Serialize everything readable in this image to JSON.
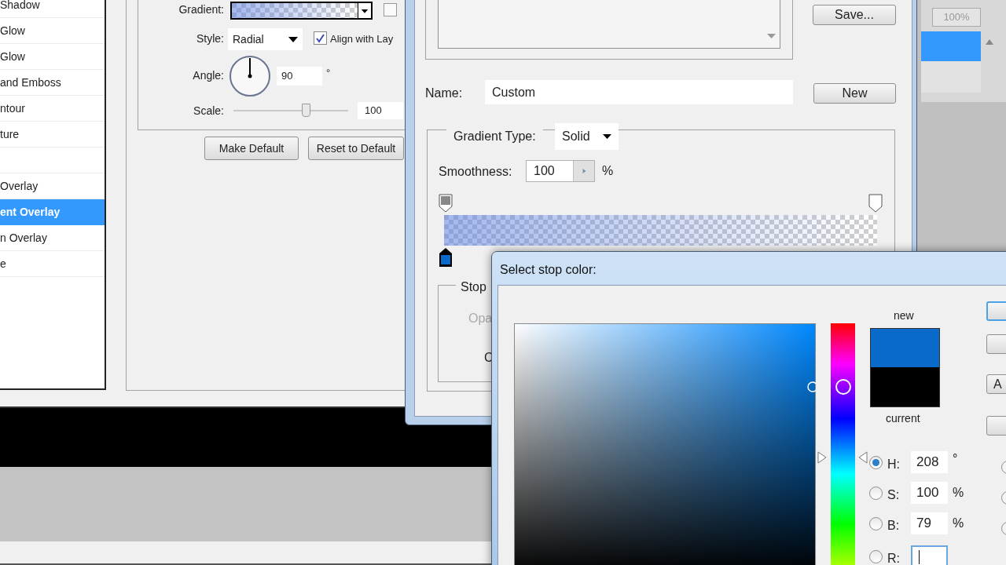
{
  "style_list": {
    "items": [
      {
        "label": "Shadow",
        "selected": false
      },
      {
        "label": "Glow",
        "selected": false
      },
      {
        "label": "Glow",
        "selected": false
      },
      {
        "label": "and Emboss",
        "selected": false
      },
      {
        "label": "ntour",
        "selected": false
      },
      {
        "label": "ture",
        "selected": false
      },
      {
        "selected": false
      },
      {
        "label": "Overlay",
        "selected": false
      },
      {
        "label": "ent Overlay",
        "selected": true
      },
      {
        "label": "n Overlay",
        "selected": false
      },
      {
        "label": "e",
        "selected": false
      }
    ]
  },
  "gradient_overlay": {
    "gradient_label": "Gradient:",
    "reverse_checked": false,
    "style_label": "Style:",
    "style_value": "Radial",
    "align_checked": true,
    "align_label": "Align with Lay",
    "angle_label": "Angle:",
    "angle_value": "90",
    "degree": "°",
    "scale_label": "Scale:",
    "scale": {
      "level": 0.63
    },
    "scale_value": "100",
    "buttons": [
      "Make Default",
      "Reset to Default"
    ]
  },
  "gradient_editor": {
    "save_button": "Save...",
    "name_label": "Name:",
    "name_value": "Custom",
    "new_button": "New",
    "gradient_type_label": "Gradient Type:",
    "gradient_type": "Solid",
    "smoothness_label": "Smoothness:",
    "smoothness_value": "100",
    "percent": "%",
    "color_stops": [
      {
        "color": "#0a6ac9"
      }
    ],
    "stops_label": "Stop",
    "opacity_label": "Opa",
    "color_label": "C"
  },
  "color_picker": {
    "title": "Select stop color:",
    "swatches": [
      {
        "label": "new",
        "color": "#0a6ac9"
      },
      {
        "label": "current",
        "color": "#000000"
      }
    ],
    "hue": {
      "level": 0.42
    },
    "fields": [
      {
        "label": "H:",
        "value": "208",
        "unit": "°",
        "selected": true
      },
      {
        "label": "S:",
        "value": "100",
        "unit": "%",
        "selected": false
      },
      {
        "label": "B:",
        "value": "79",
        "unit": "%",
        "selected": false
      },
      {
        "label": "R:",
        "selected": false
      }
    ],
    "side_buttons": [
      {
        "kind": "default"
      },
      {
        "kind": "plain"
      },
      {
        "kind": "plain",
        "label": "A"
      },
      {
        "kind": "plain"
      }
    ],
    "right_radios": [
      {
        "selected": false
      },
      {
        "selected": false
      },
      {
        "selected": false
      }
    ]
  },
  "layers_panel": {
    "zoom": "100%"
  }
}
